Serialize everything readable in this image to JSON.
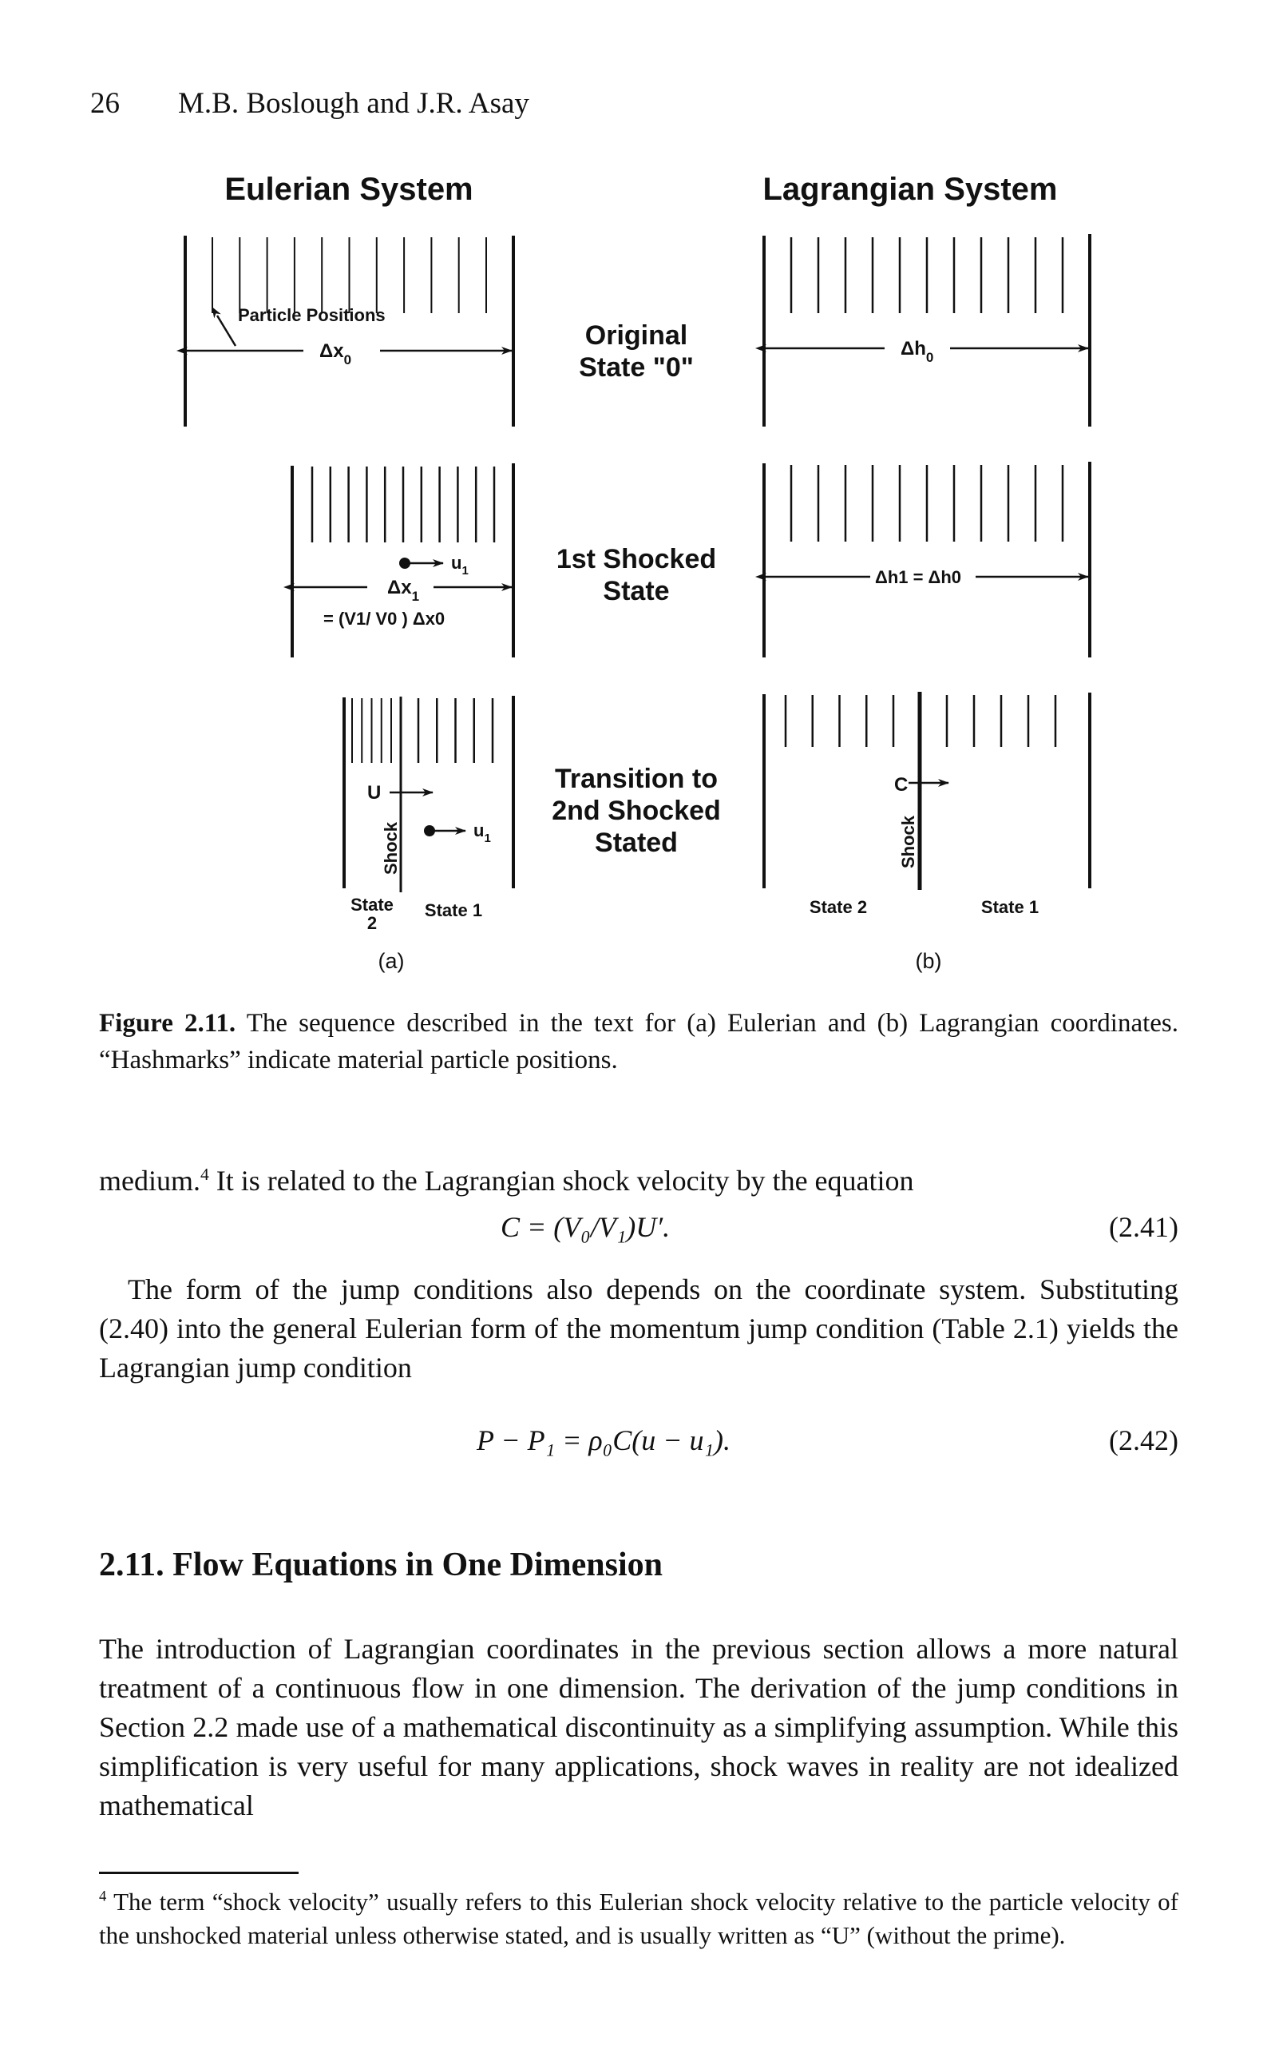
{
  "running_head": {
    "page_number": "26",
    "authors": "M.B. Boslough and J.R. Asay"
  },
  "figure": {
    "left_title": "Eulerian System",
    "right_title": "Lagrangian System",
    "rows": [
      {
        "state_label_lines": [
          "Original",
          "State \"0\""
        ],
        "eulerian": {
          "annotation": "Particle Positions",
          "dimension_label": "Δx",
          "dimension_sub": "0"
        },
        "lagrangian": {
          "dimension_label": "Δh",
          "dimension_sub": "0"
        }
      },
      {
        "state_label_lines": [
          "1st Shocked",
          "State"
        ],
        "eulerian": {
          "velocity_label": "u",
          "velocity_sub": "1",
          "dimension_label": "Δx",
          "dimension_sub": "1",
          "relation": "= (V1/ V0 ) Δx0"
        },
        "lagrangian": {
          "dimension_label": "Δh1 = Δh0"
        }
      },
      {
        "state_label_lines": [
          "Transition to",
          "2nd Shocked",
          "Stated"
        ],
        "eulerian": {
          "shock_velocity_label": "U",
          "shock_label": "Shock",
          "velocity_label": "u",
          "velocity_sub": "1",
          "left_state": [
            "State",
            "2"
          ],
          "right_state": "State 1"
        },
        "lagrangian": {
          "shock_velocity_label": "C",
          "shock_label": "Shock",
          "left_state": "State 2",
          "right_state": "State 1"
        }
      }
    ],
    "panel_labels": [
      "(a)",
      "(b)"
    ]
  },
  "caption": {
    "label": "Figure 2.11.",
    "text": " The sequence described in the text for (a) Eulerian and (b) Lagrangian coordinates. “Hashmarks” indicate material particle positions."
  },
  "body": {
    "para1_start": "medium.",
    "para1_footnote_ref": "4",
    "para1_rest": " It is related to the Lagrangian shock velocity by the equation",
    "eq241": "C = (V₀/V₁)U′.",
    "eq241_number": "(2.41)",
    "para2": "The form of the jump conditions also depends on the coordinate system. Substituting (2.40) into the general Eulerian form of the momentum jump condition (Table 2.1) yields the Lagrangian jump condition",
    "eq242": "P − P₁ = ρ₀C(u − u₁).",
    "eq242_number": "(2.42)",
    "section_title": "2.11.  Flow Equations in One Dimension",
    "para3": "The introduction of Lagrangian coordinates in the previous section allows a more natural treatment of a continuous flow in one dimension. The derivation of the jump conditions in Section 2.2 made use of a mathematical discontinuity as a simplifying assumption. While this simplification is very useful for many applications, shock waves in reality are not idealized mathematical"
  },
  "footnote": {
    "marker": "4",
    "text": " The term “shock velocity” usually refers to this Eulerian shock velocity relative to the particle velocity of the unshocked material unless otherwise stated, and is usually written as “U” (without the prime)."
  }
}
